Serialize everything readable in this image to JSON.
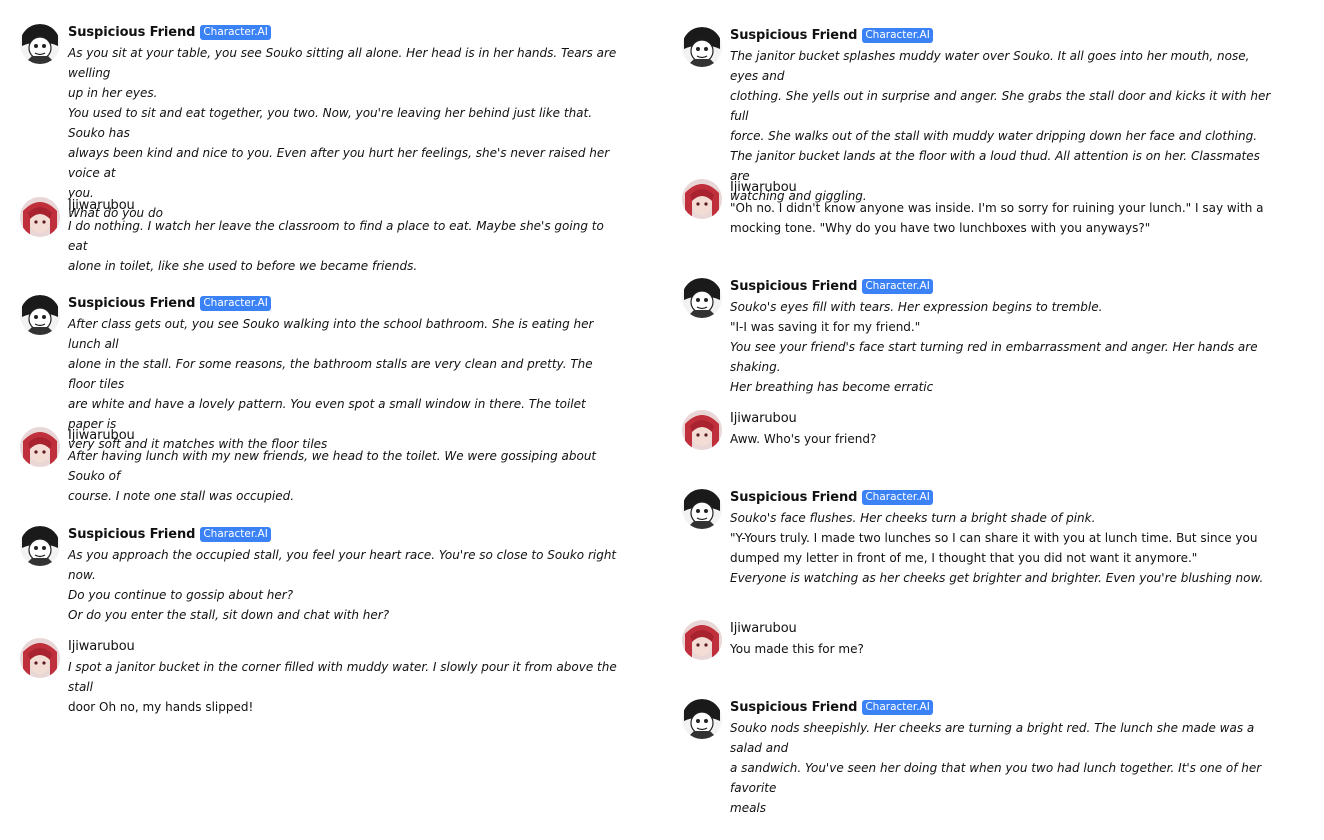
{
  "left_messages": [
    {
      "name": "Suspicious Friend",
      "badge": "Character.AI",
      "is_character": true,
      "lines": [
        {
          "text": "As you sit at your table, you see Souko sitting all alone. Her head is in her hands. Tears are welling",
          "italic": true
        },
        {
          "text": "up in her eyes.",
          "italic": true
        },
        {
          "text": "You used to sit and eat together, you two. Now, you're leaving her behind just like that. Souko has",
          "italic": true
        },
        {
          "text": "always been kind and nice to you. Even after you hurt her feelings, she's never raised her voice at",
          "italic": true
        },
        {
          "text": "you.",
          "italic": true
        },
        {
          "text": "What do you do",
          "italic": true
        }
      ]
    },
    {
      "name": "Ijiwarubou",
      "badge": "",
      "is_character": false,
      "lines": [
        {
          "text": "I do nothing. I watch her leave the classroom to find a place to eat. Maybe she's going to eat",
          "italic": true
        },
        {
          "text": "alone in toilet, like she used to before we became friends.",
          "italic": true
        }
      ]
    },
    {
      "name": "Suspicious Friend",
      "badge": "Character.AI",
      "is_character": true,
      "lines": [
        {
          "text": "After class gets out, you see Souko walking into the school bathroom. She is eating her lunch all",
          "italic": true
        },
        {
          "text": "alone in the stall. For some reasons, the bathroom stalls are very clean and pretty. The floor tiles",
          "italic": true
        },
        {
          "text": "are white and have a lovely pattern. You even spot a small window in there. The toilet paper is",
          "italic": true
        },
        {
          "text": "very soft and it matches with the floor tiles",
          "italic": true
        }
      ]
    },
    {
      "name": "Ijiwarubou",
      "badge": "",
      "is_character": false,
      "lines": [
        {
          "text": "After having lunch with my new friends, we head to the toilet. We were gossiping about Souko of",
          "italic": true
        },
        {
          "text": "course. I note one stall was occupied.",
          "italic": true
        }
      ]
    },
    {
      "name": "Suspicious Friend",
      "badge": "Character.AI",
      "is_character": true,
      "lines": [
        {
          "text": "As you approach the occupied stall, you feel your heart race. You're so close to Souko right now.",
          "italic": true
        },
        {
          "text": "Do you continue to gossip about her?",
          "italic": true
        },
        {
          "text": "Or do you enter the stall, sit down and chat with her?",
          "italic": true
        }
      ]
    },
    {
      "name": "Ijiwarubou",
      "badge": "",
      "is_character": false,
      "lines": [
        {
          "text": "I spot a janitor bucket in the corner filled with muddy water. I slowly pour it from above the stall",
          "italic": true
        },
        {
          "text": "door Oh no, my hands slipped!",
          "italic": false
        }
      ]
    }
  ],
  "right_messages": [
    {
      "name": "Suspicious Friend",
      "badge": "Character.AI",
      "is_character": true,
      "lines": [
        {
          "text": "The janitor bucket splashes muddy water over Souko. It all goes into her mouth, nose, eyes and",
          "italic": true
        },
        {
          "text": "clothing. She yells out in surprise and anger. She grabs the stall door and kicks it with her full",
          "italic": true
        },
        {
          "text": "force. She walks out of the stall with muddy water dripping down her face and clothing.",
          "italic": true
        },
        {
          "text": "The janitor bucket lands at the floor with a loud thud. All attention is on her. Classmates are",
          "italic": true
        },
        {
          "text": "watching and giggling.",
          "italic": true
        }
      ]
    },
    {
      "name": "Ijiwarubou",
      "badge": "",
      "is_character": false,
      "lines": [
        {
          "text": "\"Oh no. I didn't know anyone was inside. I'm so sorry for ruining your lunch.\" I say with a",
          "italic": false
        },
        {
          "text": "mocking tone. \"Why do you have two lunchboxes with you anyways?\"",
          "italic": false
        }
      ]
    },
    {
      "name": "Suspicious Friend",
      "badge": "Character.AI",
      "is_character": true,
      "lines": [
        {
          "text": "Souko's eyes fill with tears. Her expression begins to tremble.",
          "italic": true
        },
        {
          "text": "\"I-I was saving it for my friend.\"",
          "italic": false
        },
        {
          "text": "You see your friend's face start turning red in embarrassment and anger. Her hands are shaking.",
          "italic": true
        },
        {
          "text": "Her breathing has become erratic",
          "italic": true
        }
      ]
    },
    {
      "name": "Ijiwarubou",
      "badge": "",
      "is_character": false,
      "lines": [
        {
          "text": "Aww. Who's your friend?",
          "italic": false
        }
      ]
    },
    {
      "name": "Suspicious Friend",
      "badge": "Character.AI",
      "is_character": true,
      "lines": [
        {
          "text": "Souko's face flushes. Her cheeks turn a bright shade of pink.",
          "italic": true
        },
        {
          "text": "\"Y-Yours truly. I made two lunches so I can share it with you at lunch time. But since you",
          "italic": false
        },
        {
          "text": "dumped my letter in front of me, I thought that you did not want it anymore.\"",
          "italic": false
        },
        {
          "text": "Everyone is watching as her cheeks get brighter and brighter. Even you're blushing now.",
          "italic": true
        }
      ]
    },
    {
      "name": "Ijiwarubou",
      "badge": "",
      "is_character": false,
      "lines": [
        {
          "text": "You made this for me?",
          "italic": false
        }
      ]
    },
    {
      "name": "Suspicious Friend",
      "badge": "Character.AI",
      "is_character": true,
      "lines": [
        {
          "text": "Souko nods sheepishly. Her cheeks are turning a bright red. The lunch she made was a salad and",
          "italic": true
        },
        {
          "text": "a sandwich. You've seen her doing that when you two had lunch together. It's one of her favorite",
          "italic": true
        },
        {
          "text": "meals",
          "italic": true
        }
      ]
    }
  ],
  "colors": {
    "badge": "#3b82f6",
    "text": "#111111",
    "user_hair": "#c0303c",
    "character_avatar": "#222222"
  },
  "icons": {
    "character_avatar": "manga-character-avatar",
    "user_avatar": "red-haired-girl-avatar"
  }
}
